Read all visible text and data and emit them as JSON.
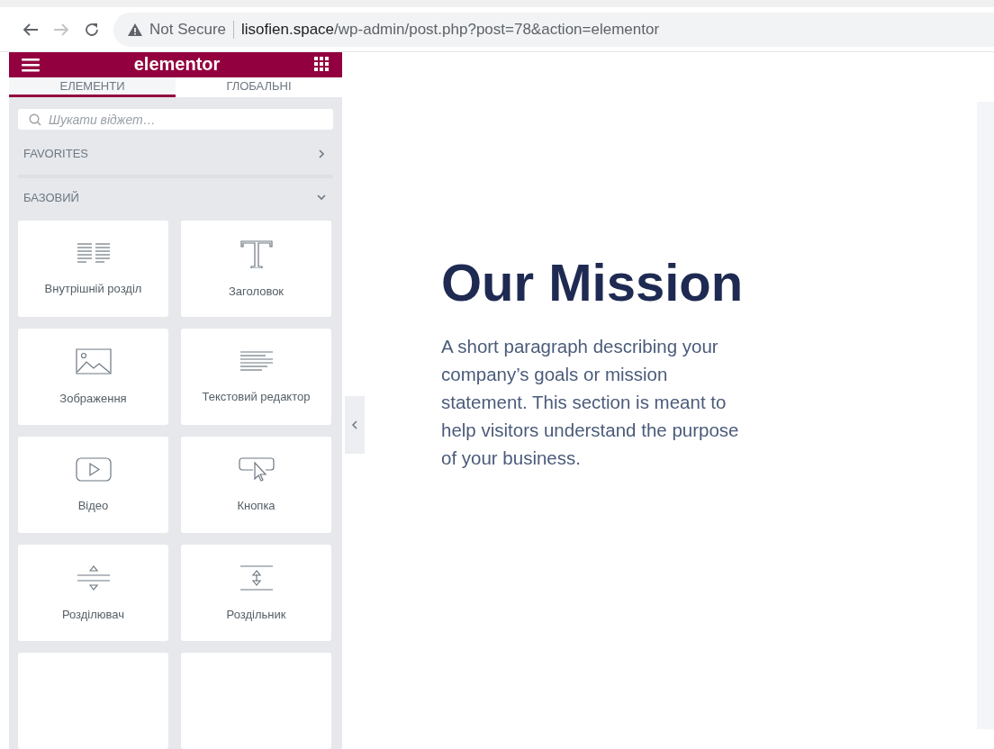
{
  "browser": {
    "security_label": "Not Secure",
    "url_host": "lisofien.space",
    "url_path": "/wp-admin/post.php?post=78&action=elementor"
  },
  "panel": {
    "logo": "elementor",
    "tabs": [
      {
        "label": "ЕЛЕМЕНТИ",
        "selected": true
      },
      {
        "label": "ГЛОБАЛЬНІ",
        "selected": false
      }
    ],
    "search": {
      "placeholder": "Шукати віджет…"
    },
    "categories": [
      {
        "title": "FAVORITES",
        "expanded": false
      },
      {
        "title": "БАЗОВИЙ",
        "expanded": true
      }
    ],
    "widgets": [
      {
        "label": "Внутрішній розділ",
        "kind": "columns"
      },
      {
        "label": "Заголовок",
        "kind": "heading"
      },
      {
        "label": "Зображення",
        "kind": "image"
      },
      {
        "label": "Текстовий редактор",
        "kind": "text"
      },
      {
        "label": "Відео",
        "kind": "video"
      },
      {
        "label": "Кнопка",
        "kind": "button"
      },
      {
        "label": "Розділювач",
        "kind": "divider"
      },
      {
        "label": "Роздільник",
        "kind": "spacer"
      }
    ]
  },
  "canvas": {
    "heading": "Our Mission",
    "paragraph": "A short paragraph describing your company’s goals or mission statement. This section is meant to help visitors understand the purpose of your business."
  }
}
